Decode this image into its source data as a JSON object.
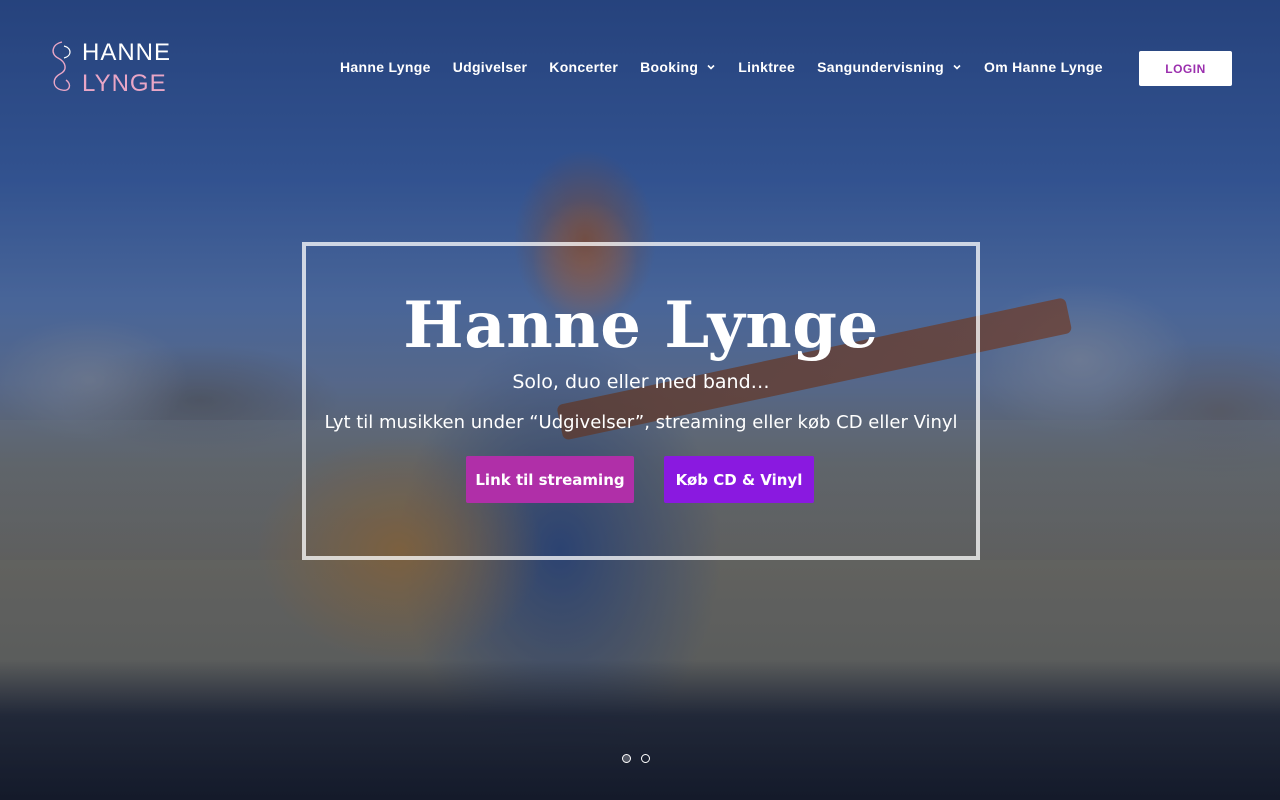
{
  "logo": {
    "line1": "HANNE",
    "line2": "LYNGE"
  },
  "nav": {
    "items": [
      {
        "label": "Hanne Lynge",
        "has_dropdown": false
      },
      {
        "label": "Udgivelser",
        "has_dropdown": false
      },
      {
        "label": "Koncerter",
        "has_dropdown": false
      },
      {
        "label": "Booking",
        "has_dropdown": true
      },
      {
        "label": "Linktree",
        "has_dropdown": false
      },
      {
        "label": "Sangundervisning",
        "has_dropdown": true
      },
      {
        "label": "Om Hanne Lynge",
        "has_dropdown": false
      }
    ],
    "login_label": "LOGIN"
  },
  "hero": {
    "title": "Hanne Lynge",
    "subtitle": "Solo, duo eller med band…",
    "description": "Lyt til musikken under “Udgivelser”, streaming eller køb CD eller Vinyl",
    "buttons": [
      {
        "label": "Link til streaming",
        "color": "#b02fa8"
      },
      {
        "label": "Køb CD & Vinyl",
        "color": "#8a19e0"
      }
    ],
    "slides": {
      "count": 2,
      "active": 1
    }
  },
  "colors": {
    "accent": "#9b2fae",
    "logo_pink": "#e9a6c6",
    "logo_white": "#ffffff"
  }
}
